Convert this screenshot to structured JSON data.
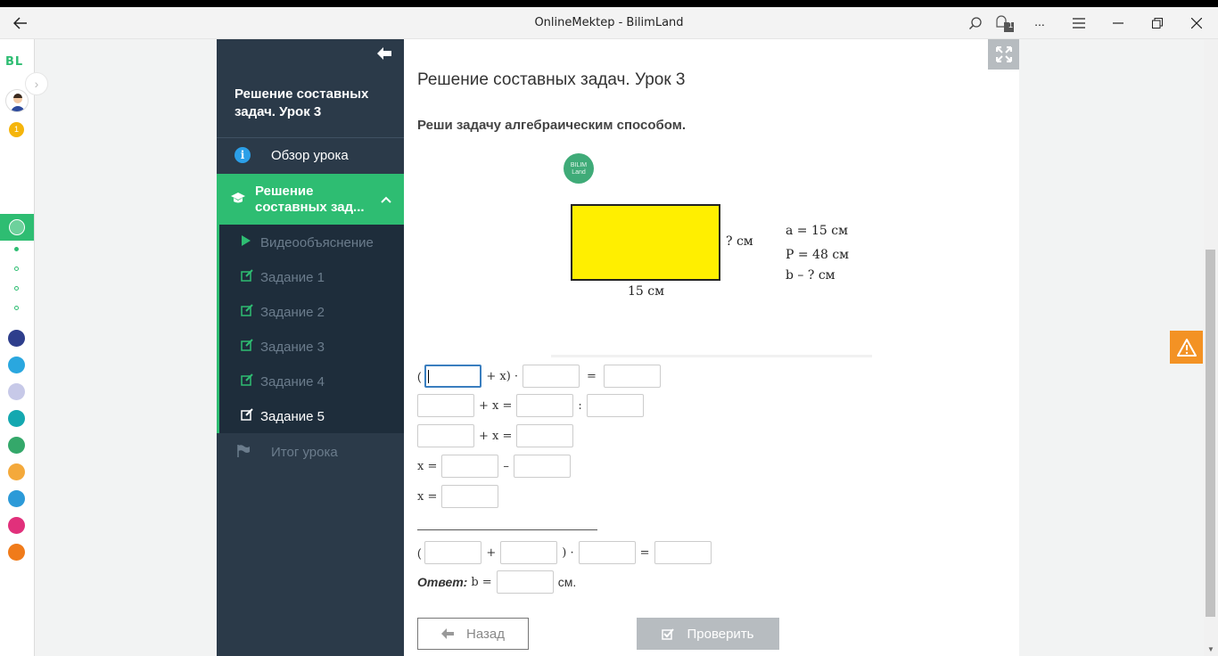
{
  "window": {
    "title": "OnlineMektep - BilimLand",
    "notification_count": "1",
    "more_label": "..."
  },
  "rail": {
    "logo": "BL",
    "badge": "1",
    "app_colors": [
      "#2e3e8c",
      "#2aa7df",
      "#c7c9e8",
      "#14a8b0",
      "#34a86a",
      "#f4a93b",
      "#2c9ad8",
      "#e1307b",
      "#f07b1a"
    ]
  },
  "sidebar": {
    "lesson_title": "Решение составных задач. Урок 3",
    "overview": "Обзор урока",
    "section": "Решение составных зад...",
    "items": [
      {
        "label": "Видеообъяснение",
        "icon": "play-icon"
      },
      {
        "label": "Задание 1",
        "icon": "edit-icon"
      },
      {
        "label": "Задание 2",
        "icon": "edit-icon"
      },
      {
        "label": "Задание 3",
        "icon": "edit-icon"
      },
      {
        "label": "Задание 4",
        "icon": "edit-icon"
      },
      {
        "label": "Задание 5",
        "icon": "edit-icon"
      }
    ],
    "summary": "Итог урока"
  },
  "main": {
    "title": "Решение составных задач. Урок 3",
    "task": "Реши задачу алгебраическим способом.",
    "logo_text": "BILIM Land",
    "figure": {
      "side_label": "? см",
      "bottom_label": "15 см",
      "given_a": "a = 15 см",
      "given_p": "P = 48 см",
      "given_b": "b – ? см"
    },
    "eq": {
      "paren_open": "(",
      "plus_x_close": "+ x) ·",
      "eq": "=",
      "plus_x_eq": "+ x =",
      "colon": ":",
      "x_eq": "x =",
      "minus": "–",
      "close_dot": ") ·",
      "plus": "+"
    },
    "answer": {
      "label": "Ответ:",
      "var": "b =",
      "unit": "см."
    },
    "back_button": "Назад",
    "check_button": "Проверить"
  },
  "colors": {
    "accent": "#2ebd72",
    "sidebar_bg": "#2b3a49",
    "warning": "#f39224",
    "rect_fill": "#ffef00"
  }
}
